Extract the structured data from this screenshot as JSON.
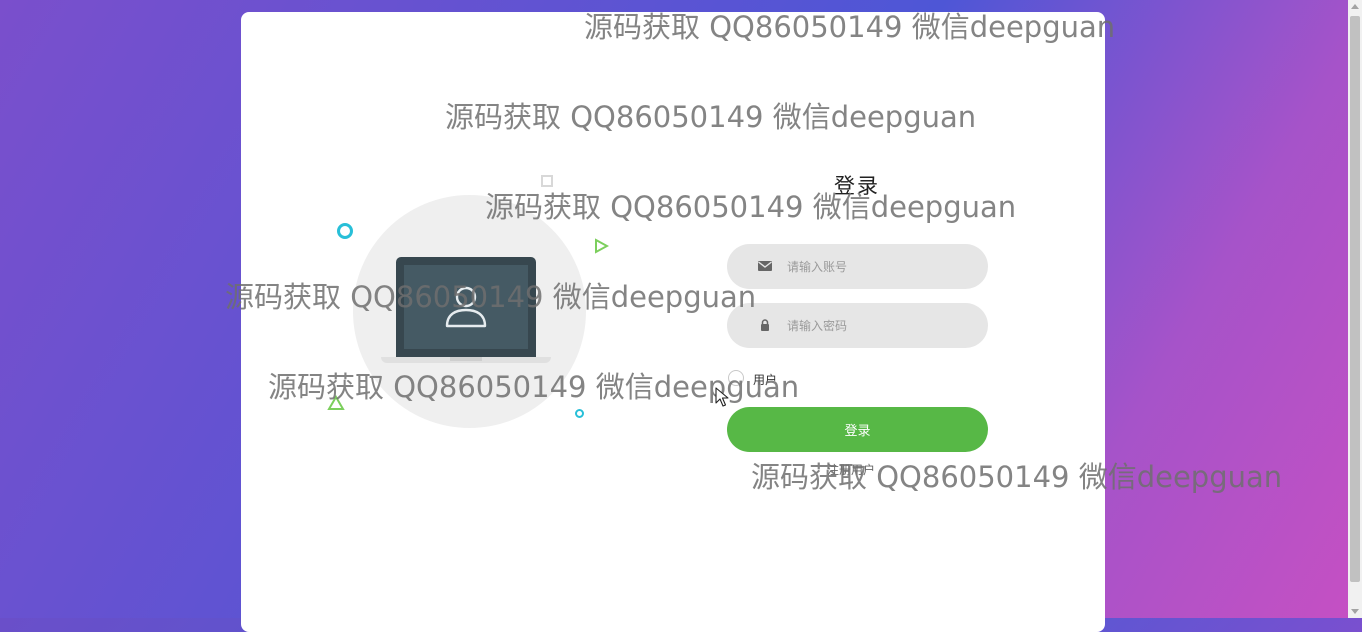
{
  "login": {
    "title": "登录",
    "account_placeholder": "请输入账号",
    "password_placeholder": "请输入密码",
    "role_label": "用户",
    "submit_label": "登录",
    "register_label": "注册用户"
  },
  "icons": {
    "account": "envelope-icon",
    "password": "lock-icon",
    "illustration": "user-laptop-icon"
  },
  "watermark": {
    "text": "源码获取 QQ86050149 微信deepguan"
  },
  "colors": {
    "accent": "#57b846",
    "field_bg": "#e6e6e6",
    "cyan_shape": "#28bfd8",
    "green_shape": "#7ccf5d"
  }
}
